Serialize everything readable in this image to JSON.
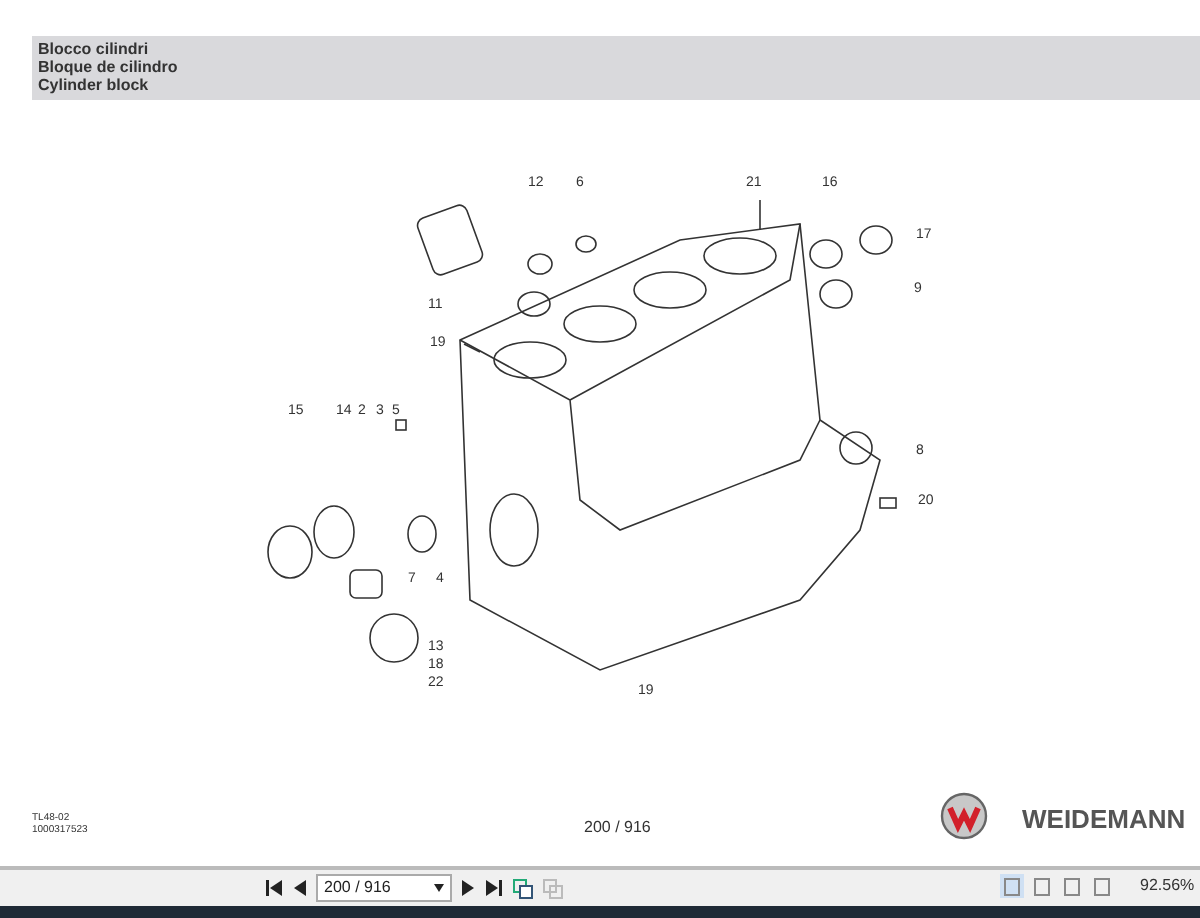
{
  "header": {
    "lines": [
      "Blocco cilindri",
      "Bloque de cilindro",
      "Cylinder block"
    ]
  },
  "callouts": [
    "12",
    "6",
    "21",
    "16",
    "17",
    "9",
    "11",
    "19",
    "15",
    "14",
    "2",
    "3",
    "5",
    "8",
    "20",
    "7",
    "4",
    "13",
    "18",
    "22",
    "19"
  ],
  "footer": {
    "codes": [
      "TL48-02",
      "1000317523"
    ],
    "page_number": "200 / 916",
    "brand": "WEIDEMANN"
  },
  "toolbar": {
    "page_field": "200 / 916",
    "view_modes": [
      {
        "selected": true
      },
      {
        "selected": false
      },
      {
        "selected": false
      },
      {
        "selected": false
      }
    ],
    "zoom": "92.56%"
  }
}
